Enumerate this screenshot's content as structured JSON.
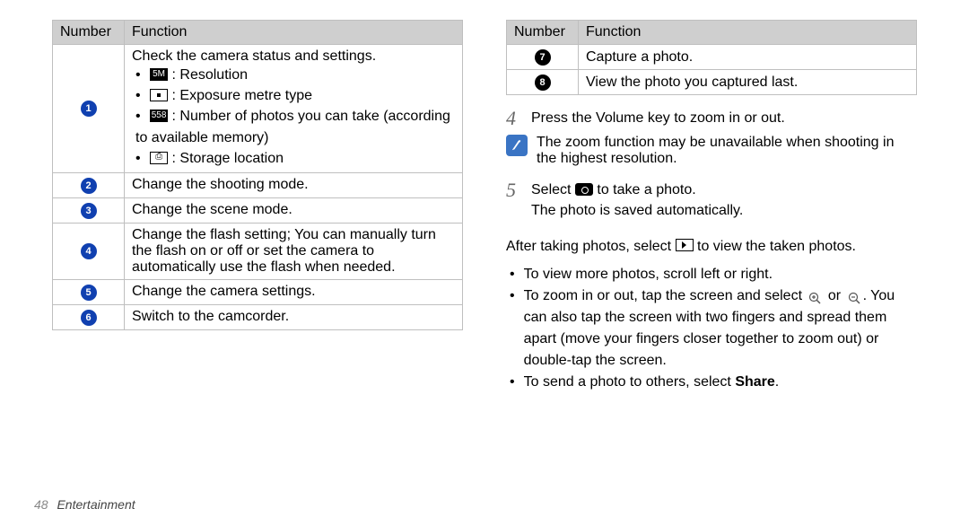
{
  "tables": {
    "left": {
      "headers": [
        "Number",
        "Function"
      ],
      "rows": [
        {
          "n": "1",
          "intro": "Check the camera status and settings.",
          "items": [
            {
              "icon": "resolution-icon",
              "iconLabel": "5M",
              "text": " : Resolution"
            },
            {
              "icon": "exposure-icon",
              "iconLabel": "",
              "text": " : Exposure metre type"
            },
            {
              "icon": "counter-icon",
              "iconLabel": "558",
              "text": " : Number of photos you can take (according to available memory)"
            },
            {
              "icon": "storage-icon",
              "iconLabel": "",
              "text": " : Storage location"
            }
          ]
        },
        {
          "n": "2",
          "text": "Change the shooting mode."
        },
        {
          "n": "3",
          "text": "Change the scene mode."
        },
        {
          "n": "4",
          "text": "Change the flash setting; You can manually turn the flash on or off or set the camera to automatically use the flash when needed."
        },
        {
          "n": "5",
          "text": "Change the camera settings."
        },
        {
          "n": "6",
          "text": "Switch to the camcorder."
        }
      ]
    },
    "right": {
      "headers": [
        "Number",
        "Function"
      ],
      "rows": [
        {
          "n": "7",
          "text": "Capture a photo."
        },
        {
          "n": "8",
          "text": "View the photo you captured last."
        }
      ]
    }
  },
  "steps": {
    "s4": {
      "n": "4",
      "text": "Press the Volume key to zoom in or out."
    },
    "s4note": "The zoom function may be unavailable when shooting in the highest resolution.",
    "s5": {
      "n": "5",
      "pre": "Select ",
      "post": " to take a photo.",
      "line2": "The photo is saved automatically."
    }
  },
  "after": {
    "para_pre": "After taking photos, select ",
    "para_post": " to view the taken photos.",
    "bullets": {
      "b1": "To view more photos, scroll left or right.",
      "b2_pre": "To zoom in or out, tap the screen and select ",
      "b2_mid": " or ",
      "b2_post": ". You can also tap the screen with two fingers and spread them apart (move your fingers closer together to zoom out) or double-tap the screen.",
      "b3_pre": "To send a photo to others, select ",
      "b3_bold": "Share",
      "b3_post": "."
    }
  },
  "footer": {
    "page": "48",
    "section": "Entertainment"
  }
}
